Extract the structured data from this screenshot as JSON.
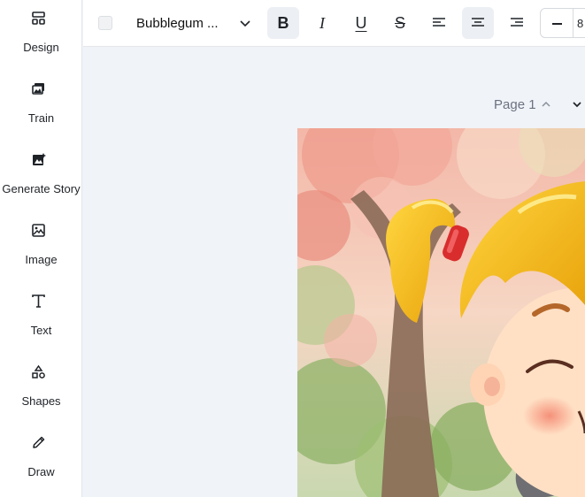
{
  "sidebar": {
    "items": [
      {
        "label": "Design",
        "icon": "layout-icon"
      },
      {
        "label": "Train",
        "icon": "images-icon"
      },
      {
        "label": "Generate Story",
        "icon": "ai-image-icon"
      },
      {
        "label": "Image",
        "icon": "image-icon"
      },
      {
        "label": "Text",
        "icon": "text-icon"
      },
      {
        "label": "Shapes",
        "icon": "shapes-icon"
      },
      {
        "label": "Draw",
        "icon": "pencil-icon"
      }
    ]
  },
  "toolbar": {
    "text_color": "#f1f2f4",
    "font_name": "Bubblegum ...",
    "bold_glyph": "B",
    "italic_glyph": "I",
    "underline_glyph": "U",
    "strike_glyph": "S",
    "font_size_partial": "8",
    "bold_active": true,
    "align_active": "center"
  },
  "canvas": {
    "page_label": "Page 1",
    "image_description_icon": "illustration-girl-with-cat"
  }
}
